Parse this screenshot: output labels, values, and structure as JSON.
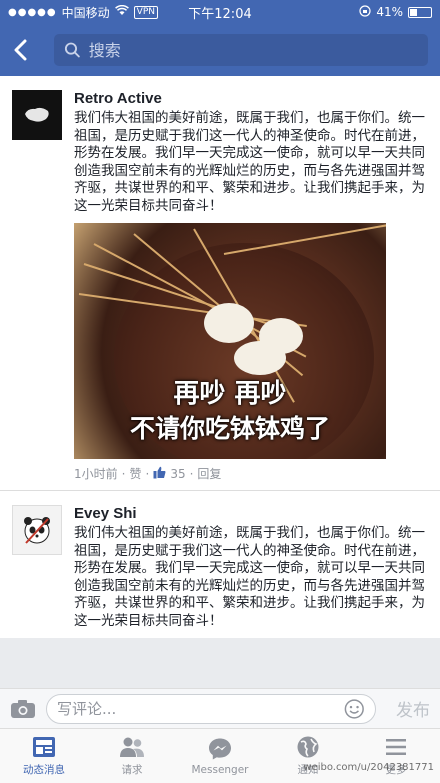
{
  "status_bar": {
    "carrier": "中国移动",
    "vpn": "VPN",
    "time": "下午12:04",
    "battery": "41%",
    "battery_level": 0.41
  },
  "search": {
    "placeholder": "搜索"
  },
  "posts": [
    {
      "author": "Retro Active",
      "avatar_text": "RETRO ACTIVE",
      "text": "我们伟大祖国的美好前途，既属于我们，也属于你们。统一祖国，是历史赋于我们这一代人的神圣使命。时代在前进，形势在发展。我们早一天完成这一使命，就可以早一天共同创造我国空前未有的光辉灿烂的历史，而与各先进强国并驾齐驱，共谋世界的和平、繁荣和进步。让我们携起手来，为这一光荣目标共同奋斗！",
      "photo_caption_1": "再吵  再吵",
      "photo_caption_2": "不请你吃钵钵鸡了",
      "time": "1小时前",
      "like_action": "赞",
      "like_count": "35",
      "reply_action": "回复"
    },
    {
      "author": "Evey Shi",
      "text": "我们伟大祖国的美好前途，既属于我们，也属于你们。统一祖国，是历史赋于我们这一代人的神圣使命。时代在前进，形势在发展。我们早一天完成这一使命，就可以早一天共同创造我国空前未有的光辉灿烂的历史，而与各先进强国并驾齐驱，共谋世界的和平、繁荣和进步。让我们携起手来，为这一光荣目标共同奋斗！"
    }
  ],
  "composer": {
    "placeholder": "写评论...",
    "send": "发布"
  },
  "tabs": [
    {
      "label": "动态消息",
      "icon": "news-feed-icon",
      "active": true
    },
    {
      "label": "请求",
      "icon": "friends-icon",
      "active": false
    },
    {
      "label": "Messenger",
      "icon": "messenger-icon",
      "active": false
    },
    {
      "label": "通知",
      "icon": "globe-icon",
      "active": false
    },
    {
      "label": "更多",
      "icon": "menu-icon",
      "active": false
    }
  ],
  "watermark": "weibo.com/u/2042381771",
  "colors": {
    "brand": "#4267b2",
    "text": "#1d2129",
    "meta": "#90949c"
  }
}
